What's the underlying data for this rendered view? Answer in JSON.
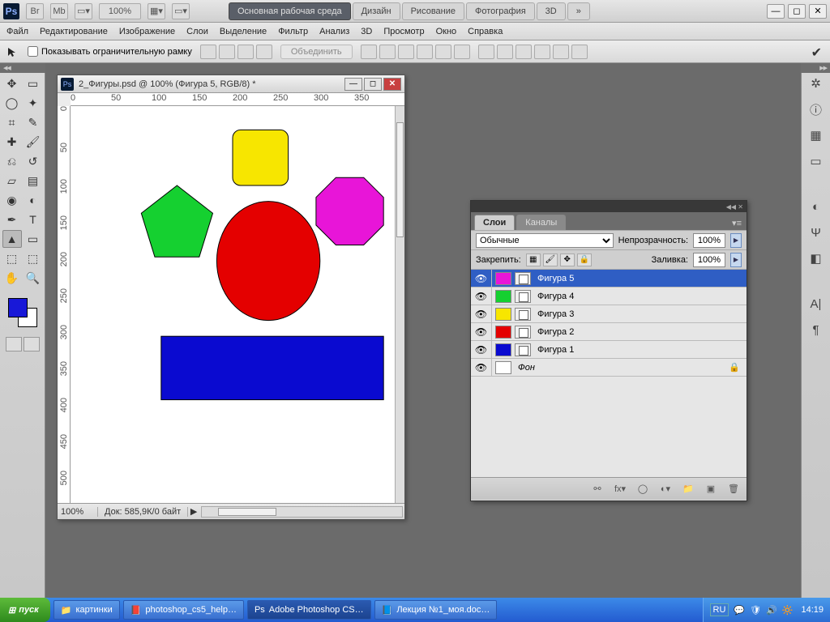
{
  "topbar": {
    "logo": "Ps",
    "zoom": "100%",
    "workspaces": [
      "Основная рабочая среда",
      "Дизайн",
      "Рисование",
      "Фотография",
      "3D"
    ],
    "active_workspace": 0
  },
  "menu": [
    "Файл",
    "Редактирование",
    "Изображение",
    "Слои",
    "Выделение",
    "Фильтр",
    "Анализ",
    "3D",
    "Просмотр",
    "Окно",
    "Справка"
  ],
  "options": {
    "show_bbox_label": "Показывать ограничительную рамку",
    "combine_label": "Объединить"
  },
  "document": {
    "title": "2_Фигуры.psd @ 100% (Фигура 5, RGB/8) *",
    "zoom": "100%",
    "status": "Док: 585,9К/0 байт",
    "ruler_h": [
      "0",
      "50",
      "100",
      "150",
      "200",
      "250",
      "300",
      "350"
    ],
    "ruler_v": [
      "0",
      "50",
      "100",
      "150",
      "200",
      "250",
      "300",
      "350",
      "400",
      "450",
      "500"
    ]
  },
  "shapes": {
    "square_color": "#f7e600",
    "pentagon_color": "#15d030",
    "ellipse_color": "#e40000",
    "octagon_color": "#e815d8",
    "rect_color": "#0a0ad0"
  },
  "layers_panel": {
    "tabs": [
      "Слои",
      "Каналы"
    ],
    "blend_mode": "Обычные",
    "opacity_label": "Непрозрачность:",
    "opacity_value": "100%",
    "lock_label": "Закрепить:",
    "fill_label": "Заливка:",
    "fill_value": "100%",
    "layers": [
      {
        "name": "Фигура 5",
        "color": "#e815d8",
        "selected": true,
        "eye": true
      },
      {
        "name": "Фигура 4",
        "color": "#15d030",
        "selected": false,
        "eye": true
      },
      {
        "name": "Фигура 3",
        "color": "#f7e600",
        "selected": false,
        "eye": true
      },
      {
        "name": "Фигура 2",
        "color": "#e40000",
        "selected": false,
        "eye": true
      },
      {
        "name": "Фигура 1",
        "color": "#0a0ad0",
        "selected": false,
        "eye": true
      }
    ],
    "background_layer": {
      "name": "Фон",
      "locked": true,
      "eye": true
    }
  },
  "taskbar": {
    "start": "пуск",
    "buttons": [
      {
        "label": "картинки",
        "icon": "📁"
      },
      {
        "label": "photoshop_cs5_help…",
        "icon": "📕"
      },
      {
        "label": "Adobe Photoshop CS…",
        "icon": "Ps",
        "active": true
      },
      {
        "label": "Лекция №1_моя.doc…",
        "icon": "📘"
      }
    ],
    "lang": "RU",
    "clock": "14:19"
  }
}
